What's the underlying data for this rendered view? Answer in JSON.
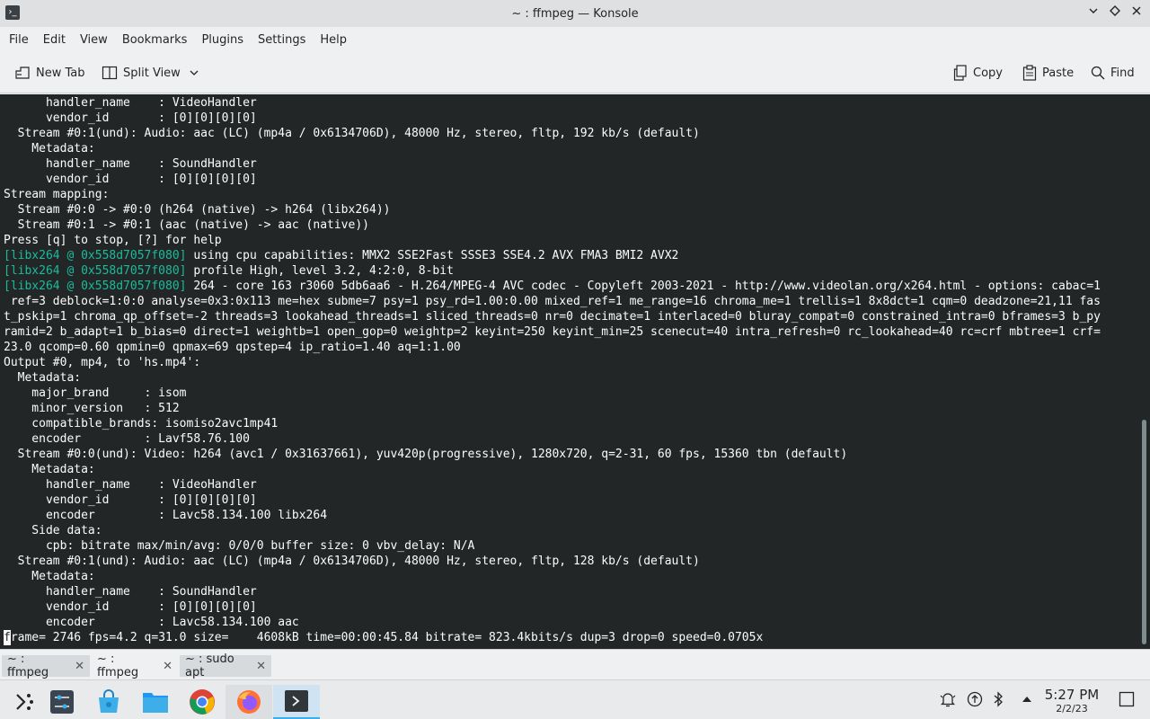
{
  "window": {
    "title": "~ : ffmpeg — Konsole",
    "app_icon": "konsole-icon",
    "controls": [
      "minimize-icon",
      "maximize-icon",
      "close-icon"
    ]
  },
  "menu": [
    "File",
    "Edit",
    "View",
    "Bookmarks",
    "Plugins",
    "Settings",
    "Help"
  ],
  "toolbar": {
    "new_tab": "New Tab",
    "split_view": "Split View",
    "copy": "Copy",
    "paste": "Paste",
    "find": "Find"
  },
  "terminal": {
    "lines": [
      {
        "tag": "",
        "text": "      handler_name    : VideoHandler"
      },
      {
        "tag": "",
        "text": "      vendor_id       : [0][0][0][0]"
      },
      {
        "tag": "",
        "text": "  Stream #0:1(und): Audio: aac (LC) (mp4a / 0x6134706D), 48000 Hz, stereo, fltp, 192 kb/s (default)"
      },
      {
        "tag": "",
        "text": "    Metadata:"
      },
      {
        "tag": "",
        "text": "      handler_name    : SoundHandler"
      },
      {
        "tag": "",
        "text": "      vendor_id       : [0][0][0][0]"
      },
      {
        "tag": "",
        "text": "Stream mapping:"
      },
      {
        "tag": "",
        "text": "  Stream #0:0 -> #0:0 (h264 (native) -> h264 (libx264))"
      },
      {
        "tag": "",
        "text": "  Stream #0:1 -> #0:1 (aac (native) -> aac (native))"
      },
      {
        "tag": "",
        "text": "Press [q] to stop, [?] for help"
      },
      {
        "tag": "[libx264 @ 0x558d7057f080]",
        "text": " using cpu capabilities: MMX2 SSE2Fast SSSE3 SSE4.2 AVX FMA3 BMI2 AVX2"
      },
      {
        "tag": "[libx264 @ 0x558d7057f080]",
        "text": " profile High, level 3.2, 4:2:0, 8-bit"
      },
      {
        "tag": "[libx264 @ 0x558d7057f080]",
        "text": " 264 - core 163 r3060 5db6aa6 - H.264/MPEG-4 AVC codec - Copyleft 2003-2021 - http://www.videolan.org/x264.html - options: cabac=1"
      },
      {
        "tag": "",
        "text": " ref=3 deblock=1:0:0 analyse=0x3:0x113 me=hex subme=7 psy=1 psy_rd=1.00:0.00 mixed_ref=1 me_range=16 chroma_me=1 trellis=1 8x8dct=1 cqm=0 deadzone=21,11 fas"
      },
      {
        "tag": "",
        "text": "t_pskip=1 chroma_qp_offset=-2 threads=3 lookahead_threads=1 sliced_threads=0 nr=0 decimate=1 interlaced=0 bluray_compat=0 constrained_intra=0 bframes=3 b_py"
      },
      {
        "tag": "",
        "text": "ramid=2 b_adapt=1 b_bias=0 direct=1 weightb=1 open_gop=0 weightp=2 keyint=250 keyint_min=25 scenecut=40 intra_refresh=0 rc_lookahead=40 rc=crf mbtree=1 crf="
      },
      {
        "tag": "",
        "text": "23.0 qcomp=0.60 qpmin=0 qpmax=69 qpstep=4 ip_ratio=1.40 aq=1:1.00"
      },
      {
        "tag": "",
        "text": "Output #0, mp4, to 'hs.mp4':"
      },
      {
        "tag": "",
        "text": "  Metadata:"
      },
      {
        "tag": "",
        "text": "    major_brand     : isom"
      },
      {
        "tag": "",
        "text": "    minor_version   : 512"
      },
      {
        "tag": "",
        "text": "    compatible_brands: isomiso2avc1mp41"
      },
      {
        "tag": "",
        "text": "    encoder         : Lavf58.76.100"
      },
      {
        "tag": "",
        "text": "  Stream #0:0(und): Video: h264 (avc1 / 0x31637661), yuv420p(progressive), 1280x720, q=2-31, 60 fps, 15360 tbn (default)"
      },
      {
        "tag": "",
        "text": "    Metadata:"
      },
      {
        "tag": "",
        "text": "      handler_name    : VideoHandler"
      },
      {
        "tag": "",
        "text": "      vendor_id       : [0][0][0][0]"
      },
      {
        "tag": "",
        "text": "      encoder         : Lavc58.134.100 libx264"
      },
      {
        "tag": "",
        "text": "    Side data:"
      },
      {
        "tag": "",
        "text": "      cpb: bitrate max/min/avg: 0/0/0 buffer size: 0 vbv_delay: N/A"
      },
      {
        "tag": "",
        "text": "  Stream #0:1(und): Audio: aac (LC) (mp4a / 0x6134706D), 48000 Hz, stereo, fltp, 128 kb/s (default)"
      },
      {
        "tag": "",
        "text": "    Metadata:"
      },
      {
        "tag": "",
        "text": "      handler_name    : SoundHandler"
      },
      {
        "tag": "",
        "text": "      vendor_id       : [0][0][0][0]"
      },
      {
        "tag": "",
        "text": "      encoder         : Lavc58.134.100 aac"
      }
    ],
    "status_cursor_char": "f",
    "status_rest": "rame= 2746 fps=4.2 q=31.0 size=    4608kB time=00:00:45.84 bitrate= 823.4kbits/s dup=3 drop=0 speed=0.0705x",
    "colors": {
      "background": "#232627",
      "foreground": "#fcfcfc",
      "tag": "#1abc9c"
    }
  },
  "tabs": [
    {
      "label": "~ : ffmpeg",
      "active": false
    },
    {
      "label": "~ : ffmpeg",
      "active": true
    },
    {
      "label": "~ : sudo apt",
      "active": false
    }
  ],
  "taskbar": {
    "apps": [
      "app-launcher-icon",
      "system-settings-icon",
      "discover-icon",
      "file-manager-icon",
      "chrome-icon",
      "firefox-icon",
      "konsole-icon"
    ],
    "tray": [
      "notifications-icon",
      "updates-icon",
      "bluetooth-icon",
      "volume-icon",
      "tray-expand-icon"
    ],
    "time": "5:27 PM",
    "date": "2/2/23"
  }
}
